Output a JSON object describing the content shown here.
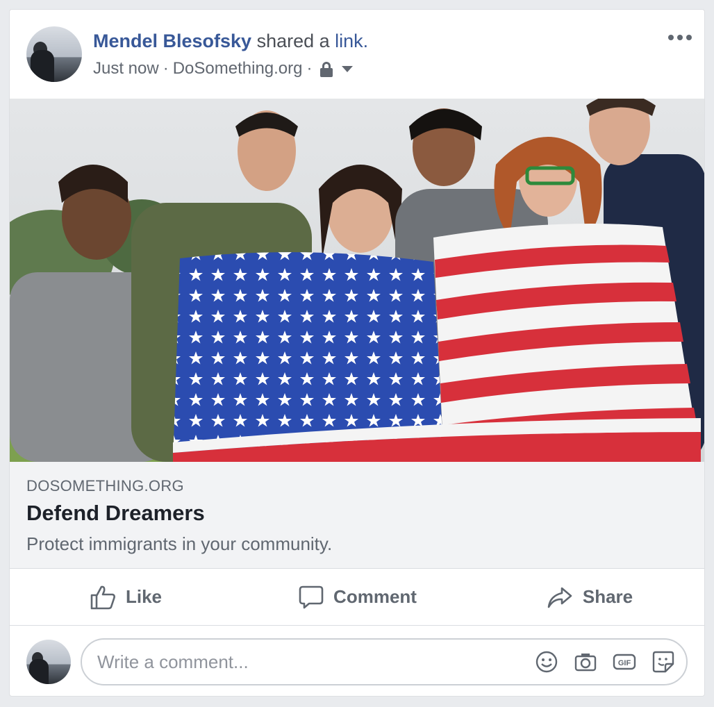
{
  "post": {
    "author": "Mendel Blesofsky",
    "action_text": " shared a ",
    "link_word": "link.",
    "time": "Just now",
    "source": "DoSomething.org",
    "separator": "·",
    "privacy_icon": "lock-icon",
    "audience_icon": "caret-down-icon",
    "options_icon": "more-options-icon"
  },
  "preview": {
    "domain": "DOSOMETHING.ORG",
    "title": "Defend Dreamers",
    "description": "Protect immigrants in your community."
  },
  "actions": {
    "like": "Like",
    "comment": "Comment",
    "share": "Share"
  },
  "composer": {
    "placeholder": "Write a comment...",
    "icons": [
      "emoji-icon",
      "camera-icon",
      "gif-icon",
      "sticker-icon"
    ]
  },
  "colors": {
    "author_link": "#385898",
    "text_secondary": "#606770",
    "card_bg": "#ffffff",
    "page_bg": "#e9ebee",
    "preview_bg": "#f2f3f5"
  }
}
